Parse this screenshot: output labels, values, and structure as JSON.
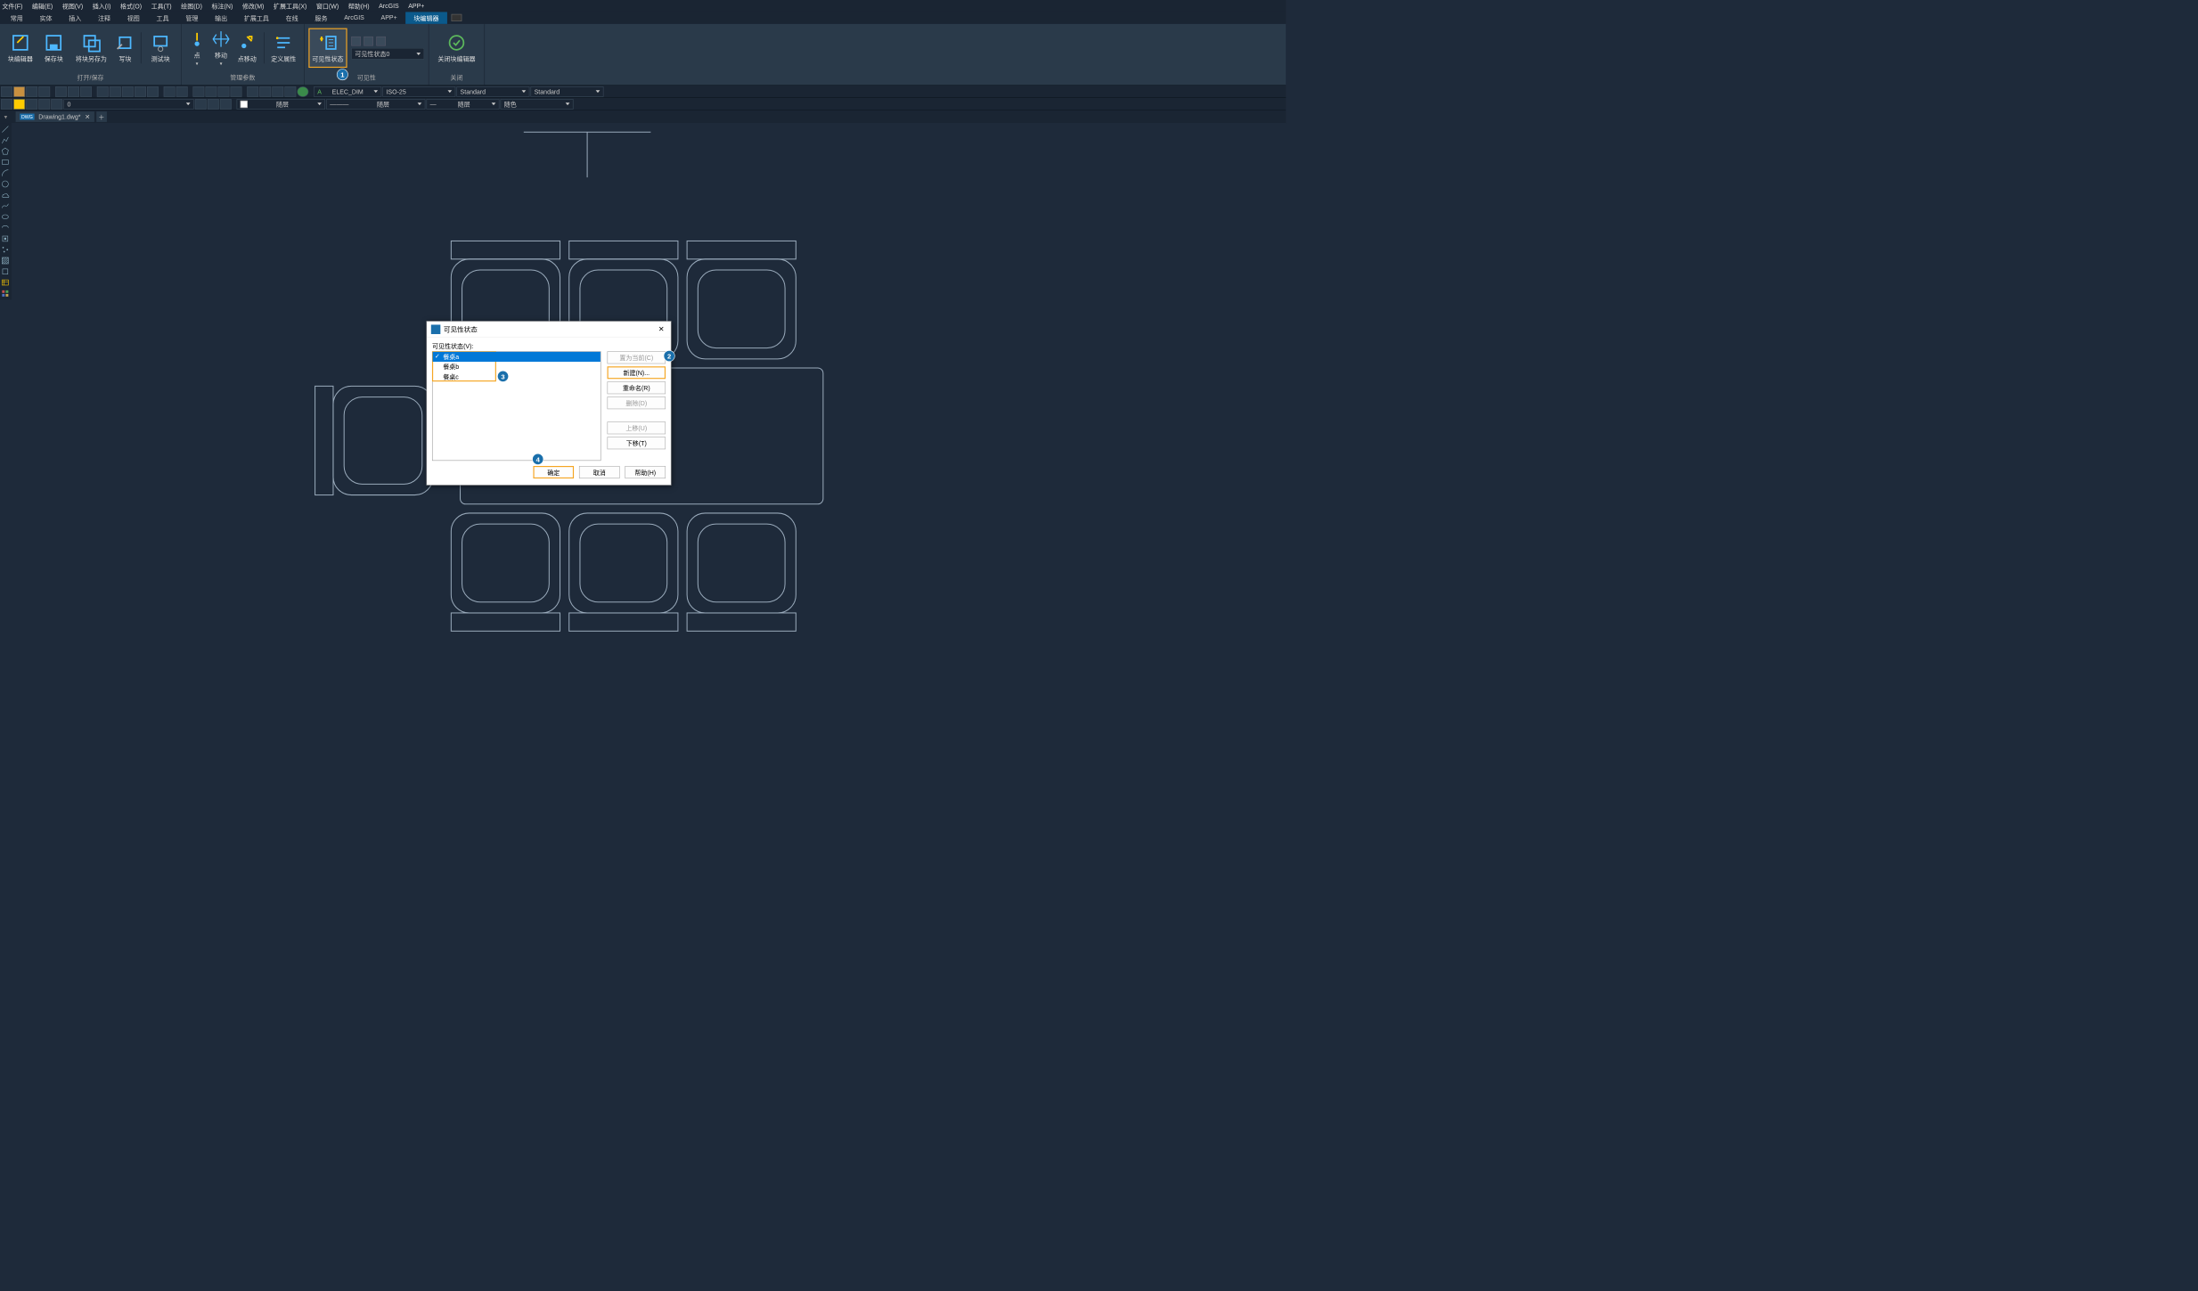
{
  "menubar": [
    "文件(F)",
    "编辑(E)",
    "视图(V)",
    "插入(I)",
    "格式(O)",
    "工具(T)",
    "绘图(D)",
    "标注(N)",
    "修改(M)",
    "扩展工具(X)",
    "窗口(W)",
    "帮助(H)",
    "ArcGIS",
    "APP+"
  ],
  "ribbon_tabs": [
    "常用",
    "实体",
    "插入",
    "注释",
    "视图",
    "工具",
    "管理",
    "输出",
    "扩展工具",
    "在线",
    "服务",
    "ArcGIS",
    "APP+",
    "块编辑器"
  ],
  "ribbon_active_tab": "块编辑器",
  "ribbon": {
    "group_open_save": {
      "label": "打开/保存",
      "btns": [
        "块编辑器",
        "保存块",
        "将块另存为",
        "写块",
        "测试块"
      ]
    },
    "group_params": {
      "label": "管理参数",
      "btns": [
        "点",
        "移动",
        "点移动",
        "定义属性"
      ]
    },
    "group_vis": {
      "label": "可见性",
      "btn": "可见性状态",
      "combo": "可见性状态0"
    },
    "group_close": {
      "label": "关闭",
      "btn": "关闭块编辑器"
    }
  },
  "badges": {
    "b1": "1",
    "b2": "2",
    "b3": "3",
    "b4": "4"
  },
  "toolbar2": {
    "layer_combo": "0",
    "dim_combo": "ELEC_DIM",
    "iso_combo": "ISO-25",
    "std1": "Standard",
    "std2": "Standard"
  },
  "toolbar3": {
    "line1": "随层",
    "line2": "随层",
    "line3": "随层",
    "color": "随色"
  },
  "doc_tab": {
    "name": "Drawing1.dwg*"
  },
  "dialog": {
    "title": "可见性状态",
    "label": "可见性状态(V):",
    "items": [
      "餐桌a",
      "餐桌b",
      "餐桌c"
    ],
    "btn_setcurrent": "置为当前(C)",
    "btn_new": "新建(N)...",
    "btn_rename": "重命名(R)",
    "btn_delete": "删除(D)",
    "btn_up": "上移(U)",
    "btn_down": "下移(T)",
    "btn_ok": "确定",
    "btn_cancel": "取消",
    "btn_help": "帮助(H)"
  }
}
